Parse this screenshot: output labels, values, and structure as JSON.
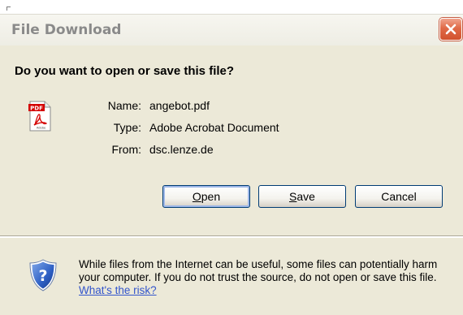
{
  "window": {
    "title": "File Download",
    "close_icon": "close-icon"
  },
  "dialog": {
    "question": "Do you want to open or save this file?",
    "file_icon": "pdf-file-icon",
    "fields": {
      "name_label": "Name:",
      "name_value": "angebot.pdf",
      "type_label": "Type:",
      "type_value": "Adobe Acrobat Document",
      "from_label": "From:",
      "from_value": "dsc.lenze.de"
    },
    "buttons": {
      "open_mnemonic": "O",
      "open_rest": "pen",
      "save_mnemonic": "S",
      "save_rest": "ave",
      "cancel": "Cancel"
    }
  },
  "warning": {
    "icon": "shield-question-icon",
    "text": "While files from the Internet can be useful, some files can potentially harm your computer. If you do not trust the source, do not open or save this file. ",
    "link": "What's the risk?"
  },
  "colors": {
    "dialog_bg": "#ece9d8",
    "close_button": "#e06a47",
    "link": "#3355cc",
    "button_border": "#003c74"
  }
}
